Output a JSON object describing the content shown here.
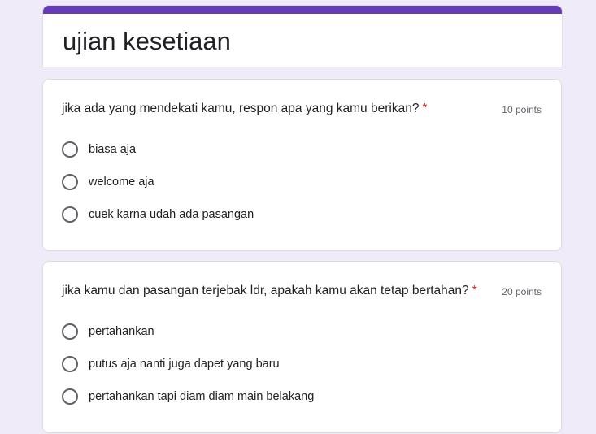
{
  "form": {
    "title": "ujian kesetiaan",
    "accent_color": "#673ab7",
    "background_color": "#efebf8"
  },
  "questions": [
    {
      "title": "jika ada yang mendekati kamu, respon apa yang kamu berikan?",
      "required_mark": "*",
      "points": "10 points",
      "options": [
        {
          "label": "biasa aja",
          "selected": false
        },
        {
          "label": "welcome aja",
          "selected": false
        },
        {
          "label": "cuek karna udah ada pasangan",
          "selected": false
        }
      ]
    },
    {
      "title": "jika kamu dan pasangan terjebak ldr, apakah kamu akan tetap bertahan?",
      "required_mark": "*",
      "points": "20 points",
      "options": [
        {
          "label": "pertahankan",
          "selected": false
        },
        {
          "label": "putus aja nanti juga dapet yang baru",
          "selected": false
        },
        {
          "label": "pertahankan tapi diam diam main belakang",
          "selected": false
        }
      ]
    }
  ],
  "icons": {
    "radio": "radio-unchecked-icon"
  }
}
